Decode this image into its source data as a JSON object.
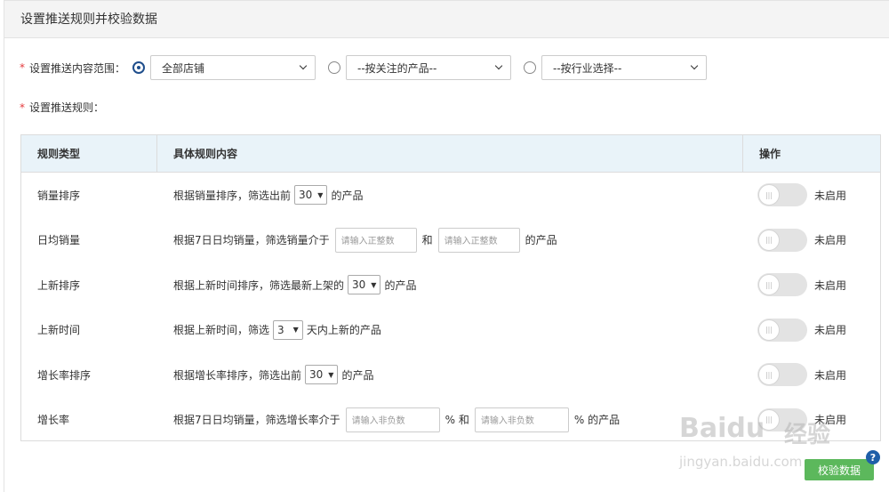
{
  "panel": {
    "title": "设置推送规则并校验数据"
  },
  "scope": {
    "required_mark": "*",
    "label": "设置推送内容范围：",
    "options": [
      {
        "value": "全部店铺",
        "checked": true
      },
      {
        "value": "--按关注的产品--",
        "checked": false
      },
      {
        "value": "--按行业选择--",
        "checked": false
      }
    ]
  },
  "rules_label": {
    "required_mark": "*",
    "label": "设置推送规则："
  },
  "table": {
    "headers": [
      "规则类型",
      "具体规则内容",
      "操作"
    ],
    "rows": [
      {
        "type": "销量排序",
        "parts": {
          "pre": "根据销量排序，筛选出前",
          "select": "30",
          "post": "的产品"
        },
        "status": "未启用"
      },
      {
        "type": "日均销量",
        "parts": {
          "pre": "根据7日日均销量，筛选销量介于",
          "input1": "请输入正整数",
          "mid": "和",
          "input2": "请输入正整数",
          "post": "的产品"
        },
        "status": "未启用"
      },
      {
        "type": "上新排序",
        "parts": {
          "pre": "根据上新时间排序，筛选最新上架的",
          "select": "30",
          "post": "的产品"
        },
        "status": "未启用"
      },
      {
        "type": "上新时间",
        "parts": {
          "pre": "根据上新时间，筛选",
          "select": "3",
          "post": "天内上新的产品"
        },
        "status": "未启用"
      },
      {
        "type": "增长率排序",
        "parts": {
          "pre": "根据增长率排序，筛选出前",
          "select": "30",
          "post": "的产品"
        },
        "status": "未启用"
      },
      {
        "type": "增长率",
        "parts": {
          "pre": "根据7日日均销量，筛选增长率介于",
          "input1": "请输入非负数",
          "mid": "% 和",
          "input2": "请输入非负数",
          "post": "% 的产品"
        },
        "status": "未启用"
      }
    ]
  },
  "footer": {
    "verify_button": "校验数据",
    "help_badge": "?"
  },
  "watermark": {
    "brand": "Baidu",
    "brand_cn": "经验",
    "url": "jingyan.baidu.com"
  },
  "colors": {
    "accent_radio": "#1f4e8c",
    "verify_button": "#5cb85c",
    "table_header_bg": "#e9f3f9",
    "required": "#e4393c"
  }
}
